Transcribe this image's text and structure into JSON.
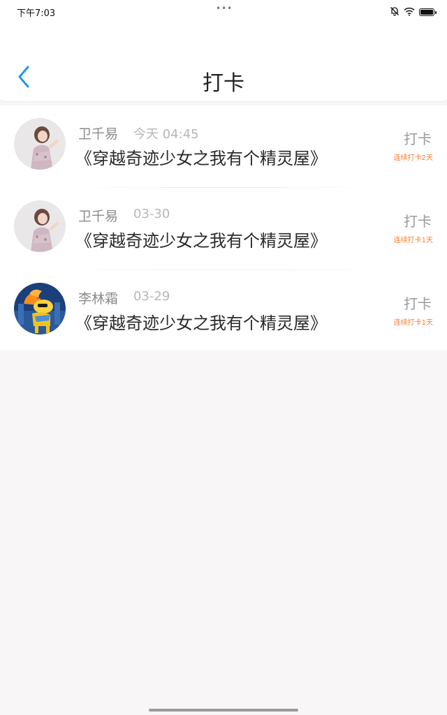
{
  "status_bar": {
    "time": "下午7:03",
    "dots": "•••",
    "icons": [
      "mute-bell-icon",
      "wifi-icon",
      "battery-icon"
    ]
  },
  "header": {
    "title": "打卡",
    "back_icon": "chevron-left-icon"
  },
  "records": [
    {
      "name": "卫千易",
      "time": "今天 04:45",
      "book": "《穿越奇迹少女之我有个精灵屋》",
      "checkin_label": "打卡",
      "streak": "连续打卡2天",
      "avatar": "girl-avatar"
    },
    {
      "name": "卫千易",
      "time": "03-30",
      "book": "《穿越奇迹少女之我有个精灵屋》",
      "checkin_label": "打卡",
      "streak": "连续打卡1天",
      "avatar": "girl-avatar"
    },
    {
      "name": "李林霜",
      "time": "03-29",
      "book": "《穿越奇迹少女之我有个精灵屋》",
      "checkin_label": "打卡",
      "streak": "连续打卡1天",
      "avatar": "pony-avatar"
    }
  ],
  "colors": {
    "accent_blue": "#2196f3",
    "streak_orange": "#ff7a2e",
    "page_bg": "#f8f6f7"
  }
}
